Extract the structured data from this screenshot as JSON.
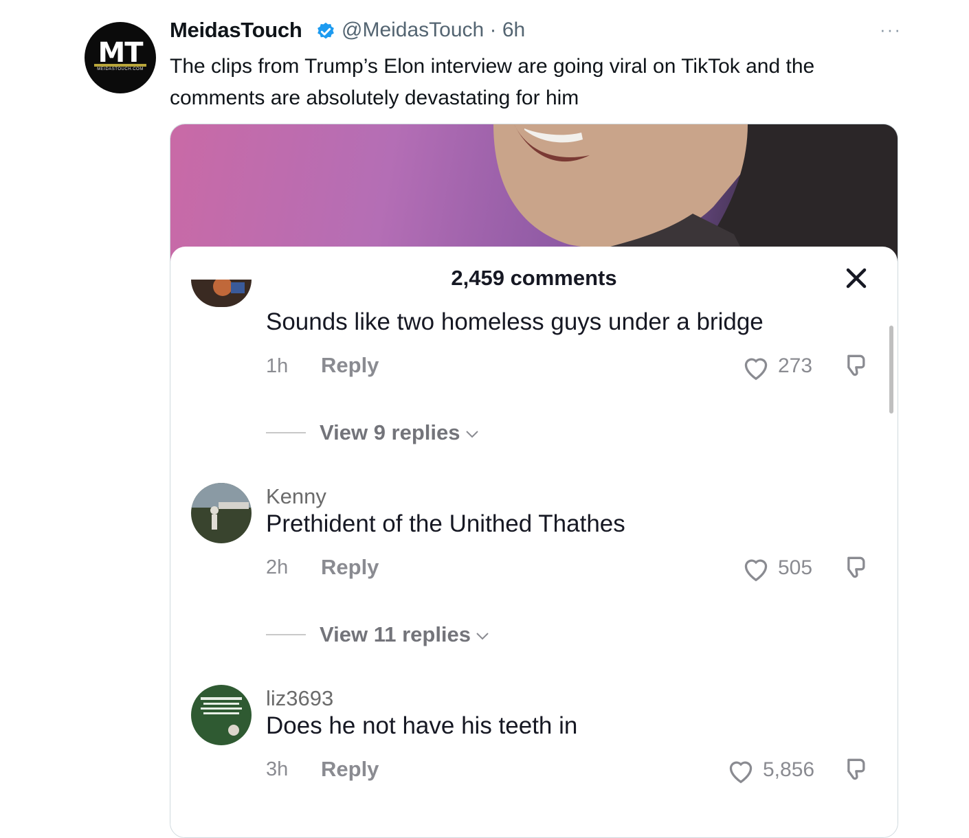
{
  "tweet": {
    "author_name": "MeidasTouch",
    "handle_time": "@MeidasTouch · 6h",
    "more": "···",
    "text": "The clips from Trump’s Elon interview are going viral on TikTok and the comments are absolutely devastating for him",
    "avatar": {
      "initials": "MT",
      "subtext": "MEIDASTOUCH.COM"
    }
  },
  "media": {
    "comments_count": "2,459 comments",
    "close_icon": "close-icon",
    "comments": [
      {
        "user": "",
        "text": "Sounds like two homeless guys under a bridge",
        "time": "1h",
        "reply": "Reply",
        "likes": "273",
        "view_replies": "View 9 replies"
      },
      {
        "user": "Kenny",
        "text": "Prethident of the Unithed Thathes",
        "time": "2h",
        "reply": "Reply",
        "likes": "505",
        "view_replies": "View 11 replies"
      },
      {
        "user": "liz3693",
        "text": "Does he not have his teeth in",
        "time": "3h",
        "reply": "Reply",
        "likes": "5,856",
        "view_replies": ""
      }
    ]
  },
  "colors": {
    "verified": "#1d9bf0",
    "handle": "#536471",
    "muted": "#8a8b91"
  }
}
